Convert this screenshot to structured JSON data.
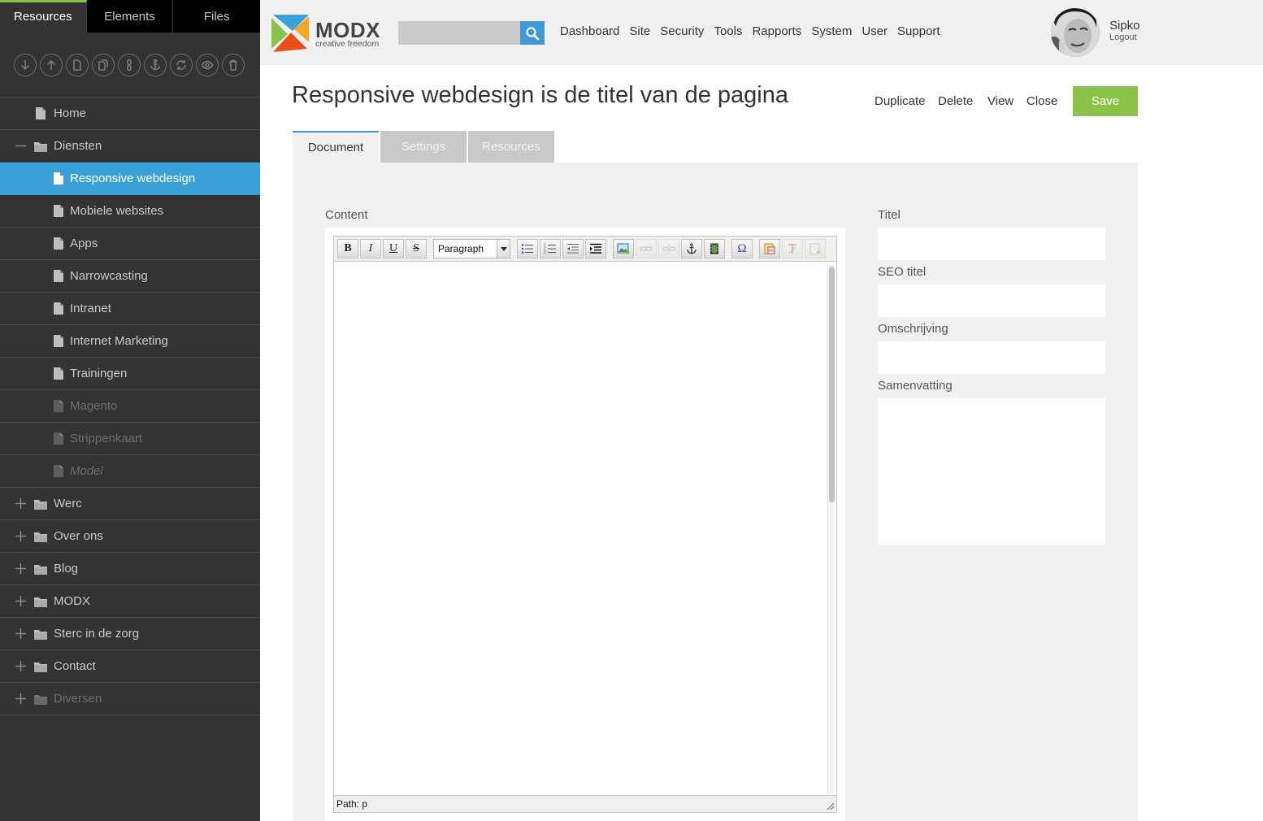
{
  "sidebar": {
    "tabs": [
      "Resources",
      "Elements",
      "Files"
    ],
    "toolbar_icons": [
      "download-icon",
      "upload-icon",
      "new-document-icon",
      "copy-document-icon",
      "weblink-icon",
      "anchor-icon",
      "refresh-icon",
      "preview-icon",
      "trash-icon"
    ],
    "tree": [
      {
        "label": "Home",
        "type": "doc",
        "level": 0
      },
      {
        "label": "Diensten",
        "type": "folder",
        "level": 0,
        "expander": "minus"
      },
      {
        "label": "Responsive webdesign",
        "type": "doc",
        "level": 1,
        "state": "active"
      },
      {
        "label": "Mobiele websites",
        "type": "doc",
        "level": 1
      },
      {
        "label": "Apps",
        "type": "doc",
        "level": 1
      },
      {
        "label": "Narrowcasting",
        "type": "doc",
        "level": 1
      },
      {
        "label": "Intranet",
        "type": "doc",
        "level": 1
      },
      {
        "label": "Internet Marketing",
        "type": "doc",
        "level": 1
      },
      {
        "label": "Trainingen",
        "type": "doc",
        "level": 1
      },
      {
        "label": "Magento",
        "type": "doc",
        "level": 1,
        "state": "unpublished"
      },
      {
        "label": "Strippenkaart",
        "type": "doc",
        "level": 1,
        "state": "unpublished"
      },
      {
        "label": "Model",
        "type": "doc",
        "level": 1,
        "state": "hidden"
      },
      {
        "label": "Werc",
        "type": "folder",
        "level": 0,
        "expander": "plus"
      },
      {
        "label": "Over ons",
        "type": "folder",
        "level": 0,
        "expander": "plus"
      },
      {
        "label": "Blog",
        "type": "folder",
        "level": 0,
        "expander": "plus"
      },
      {
        "label": "MODX",
        "type": "folder",
        "level": 0,
        "expander": "plus"
      },
      {
        "label": "Sterc in de zorg",
        "type": "folder",
        "level": 0,
        "expander": "plus"
      },
      {
        "label": "Contact",
        "type": "folder",
        "level": 0,
        "expander": "plus"
      },
      {
        "label": "Diversen",
        "type": "folder",
        "level": 0,
        "expander": "plus",
        "state": "unpublished"
      }
    ]
  },
  "header": {
    "logo_text": "MODX",
    "logo_tagline": "creative freedom",
    "search_placeholder": "",
    "nav": [
      "Dashboard",
      "Site",
      "Security",
      "Tools",
      "Rapports",
      "System",
      "User",
      "Support"
    ],
    "username": "Sipko",
    "logout_label": "Logout"
  },
  "page": {
    "title": "Responsive webdesign is de titel van de pagina",
    "actions": {
      "duplicate": "Duplicate",
      "delete": "Delete",
      "view": "View",
      "close": "Close",
      "save": "Save"
    },
    "tabs": {
      "document": "Document",
      "settings": "Settings",
      "resources": "Resources"
    },
    "active_tab": "Document"
  },
  "content": {
    "label": "Content",
    "editor": {
      "format_value": "Paragraph",
      "path_label": "Path: p",
      "buttons": [
        "bold",
        "italic",
        "underline",
        "strikethrough",
        "bullet-list",
        "numbered-list",
        "outdent",
        "indent",
        "image",
        "link",
        "unlink",
        "anchor",
        "media",
        "special-char",
        "paste-word",
        "cleanup",
        "code"
      ]
    }
  },
  "fields": {
    "titel_label": "Titel",
    "titel_value": "",
    "seo_label": "SEO titel",
    "seo_value": "",
    "omschrijving_label": "Omschrijving",
    "omschrijving_value": "",
    "samenvatting_label": "Samenvatting",
    "samenvatting_value": ""
  },
  "colors": {
    "accent_blue": "#3d9ad6",
    "save_green": "#8bc34a",
    "sidebar_bg": "#333333",
    "active_item": "#3aa0d8"
  }
}
